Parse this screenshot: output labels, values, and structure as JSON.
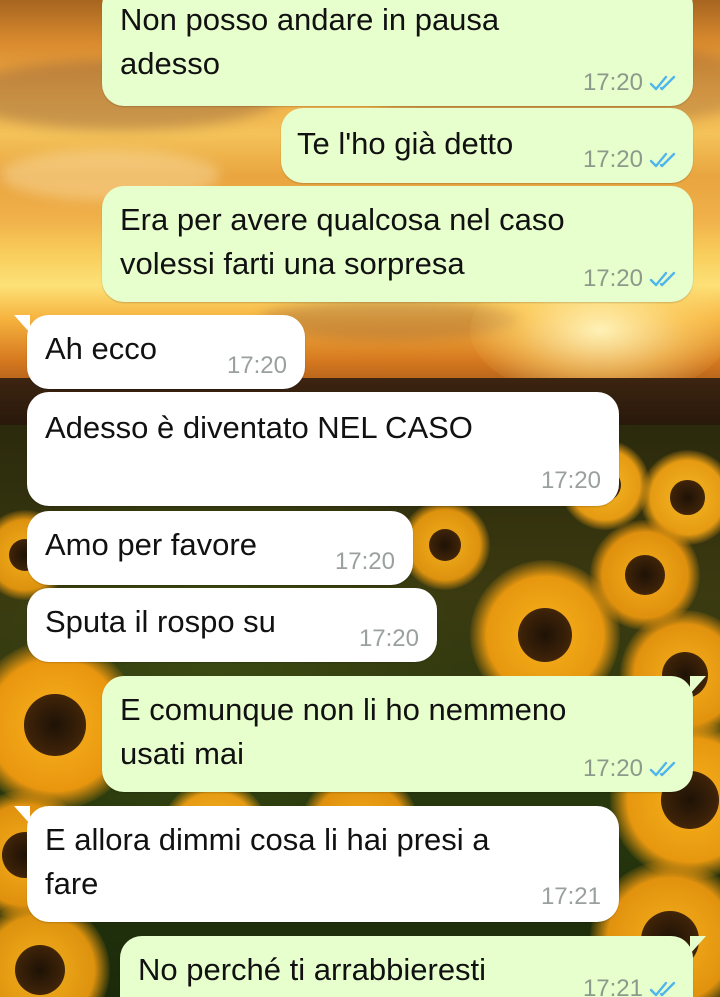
{
  "conversation": {
    "messages": [
      {
        "id": "m1",
        "direction": "outgoing",
        "text": "Non posso andare in pausa\nadesso",
        "time": "17:20",
        "status": "read"
      },
      {
        "id": "m2",
        "direction": "outgoing",
        "text": "Te l'ho già detto",
        "time": "17:20",
        "status": "read"
      },
      {
        "id": "m3",
        "direction": "outgoing",
        "text": "Era per avere qualcosa nel caso\nvolessi farti una sorpresa",
        "time": "17:20",
        "status": "read"
      },
      {
        "id": "m4",
        "direction": "incoming",
        "text": "Ah ecco",
        "time": "17:20"
      },
      {
        "id": "m5",
        "direction": "incoming",
        "text": "Adesso è diventato NEL CASO",
        "time": "17:20"
      },
      {
        "id": "m6",
        "direction": "incoming",
        "text": "Amo per favore",
        "time": "17:20"
      },
      {
        "id": "m7",
        "direction": "incoming",
        "text": "Sputa il rospo su",
        "time": "17:20"
      },
      {
        "id": "m8",
        "direction": "outgoing",
        "text": "E comunque non li ho nemmeno\nusati mai",
        "time": "17:20",
        "status": "read"
      },
      {
        "id": "m9",
        "direction": "incoming",
        "text": "E allora dimmi cosa li hai presi a\nfare",
        "time": "17:21"
      },
      {
        "id": "m10",
        "direction": "outgoing",
        "text": "No perché ti arrabbieresti",
        "time": "17:21",
        "status": "read"
      }
    ]
  },
  "theme": {
    "outgoing_bubble": "#e7fecd",
    "incoming_bubble": "#ffffff",
    "read_tick_color": "#4fb6ec",
    "text_color": "#111111"
  },
  "icons": {
    "read_receipt": "double-check-icon"
  }
}
